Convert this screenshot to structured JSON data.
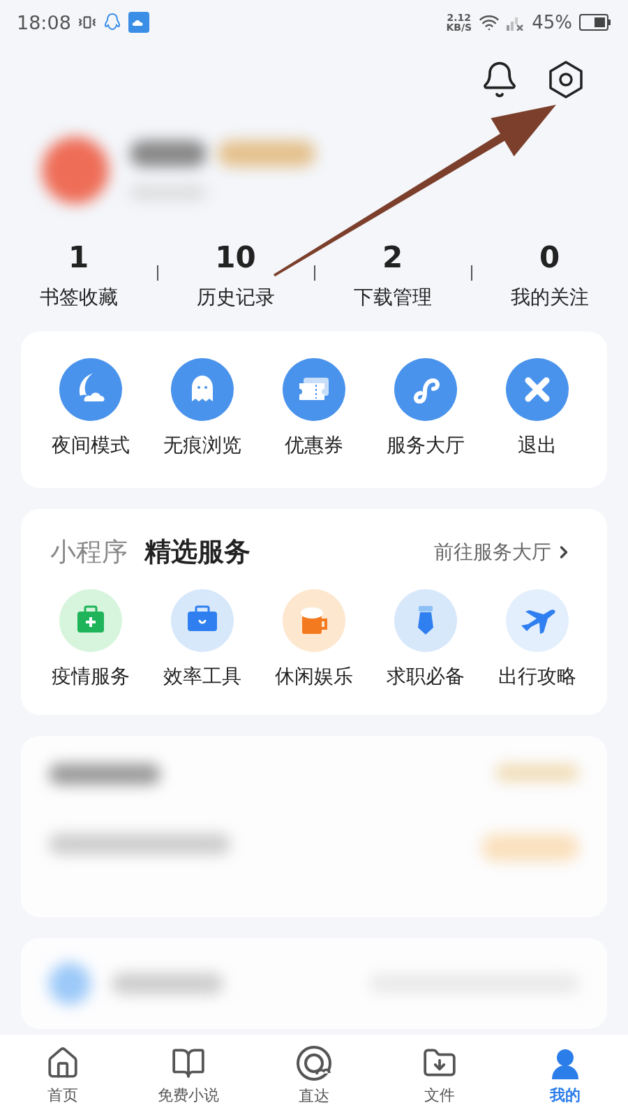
{
  "status_bar": {
    "time": "18:08",
    "speed": "2.12",
    "speed_unit": "KB/S",
    "battery": "45%"
  },
  "stats": [
    {
      "value": "1",
      "label": "书签收藏"
    },
    {
      "value": "10",
      "label": "历史记录"
    },
    {
      "value": "2",
      "label": "下载管理"
    },
    {
      "value": "0",
      "label": "我的关注"
    }
  ],
  "quick_actions": [
    {
      "kind": "night",
      "label": "夜间模式"
    },
    {
      "kind": "incognito",
      "label": "无痕浏览"
    },
    {
      "kind": "coupon",
      "label": "优惠券"
    },
    {
      "kind": "service",
      "label": "服务大厅"
    },
    {
      "kind": "exit",
      "label": "退出"
    }
  ],
  "services": {
    "tabs": [
      {
        "label": "小程序",
        "selected": false
      },
      {
        "label": "精选服务",
        "selected": true
      }
    ],
    "link": "前往服务大厅",
    "items": [
      {
        "kind": "medical",
        "label": "疫情服务"
      },
      {
        "kind": "briefcase",
        "label": "效率工具"
      },
      {
        "kind": "beer",
        "label": "休闲娱乐"
      },
      {
        "kind": "tie",
        "label": "求职必备"
      },
      {
        "kind": "plane",
        "label": "出行攻略"
      }
    ]
  },
  "bottom_nav": [
    {
      "kind": "home",
      "label": "首页",
      "selected": false
    },
    {
      "kind": "book",
      "label": "免费小说",
      "selected": false
    },
    {
      "kind": "direct",
      "label": "直达",
      "selected": false
    },
    {
      "kind": "files",
      "label": "文件",
      "selected": false
    },
    {
      "kind": "me",
      "label": "我的",
      "selected": true
    }
  ]
}
